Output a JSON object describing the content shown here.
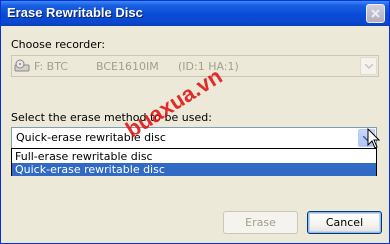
{
  "window": {
    "title": "Erase Rewritable Disc"
  },
  "recorder": {
    "label": "Choose recorder:",
    "drive": "F: BTC",
    "model": "BCE1610IM",
    "address": "(ID:1 HA:1)"
  },
  "erase": {
    "label": "Select the erase method to be used:",
    "selected": "Quick-erase rewritable disc",
    "options": [
      "Full-erase rewritable disc",
      "Quick-erase rewritable disc"
    ],
    "highlighted_index": 1
  },
  "buttons": {
    "erase": "Erase",
    "cancel": "Cancel"
  },
  "watermark": "buaxua.vn",
  "icons": {
    "close": "close-icon",
    "recorder": "cd-drive-icon",
    "dropdown": "chevron-down-icon",
    "cursor": "mouse-pointer-icon"
  },
  "colors": {
    "titlebar": "#0a4ad8",
    "selection": "#316ac5",
    "watermark": "#e01818"
  }
}
